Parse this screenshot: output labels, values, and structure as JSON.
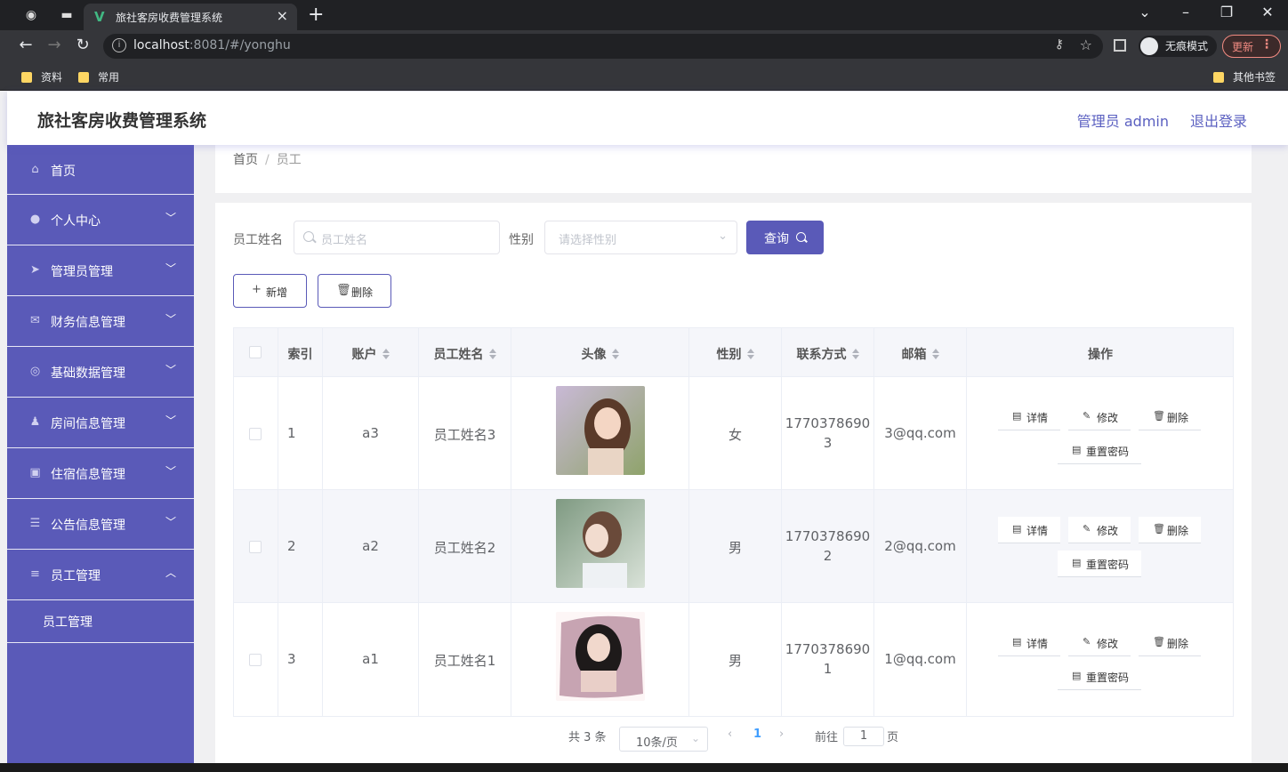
{
  "browser": {
    "tab_title": "旅社客房收费管理系统",
    "url_host": "localhost",
    "url_path": ":8081/#/yonghu",
    "incognito_label": "无痕模式",
    "update_label": "更新",
    "bookmarks": [
      "资料",
      "常用"
    ],
    "other_bookmarks": "其他书签"
  },
  "header": {
    "title": "旅社客房收费管理系统",
    "admin_label": "管理员 admin",
    "logout_label": "退出登录"
  },
  "sidebar": {
    "items": [
      {
        "label": "首页",
        "icon": "home-icon"
      },
      {
        "label": "个人中心",
        "icon": "user-icon"
      },
      {
        "label": "管理员管理",
        "icon": "send-icon"
      },
      {
        "label": "财务信息管理",
        "icon": "mail-icon"
      },
      {
        "label": "基础数据管理",
        "icon": "circle-icon"
      },
      {
        "label": "房间信息管理",
        "icon": "person-icon"
      },
      {
        "label": "住宿信息管理",
        "icon": "clipboard-icon"
      },
      {
        "label": "公告信息管理",
        "icon": "sliders-icon"
      },
      {
        "label": "员工管理",
        "icon": "list-icon"
      }
    ],
    "sub_item": "员工管理"
  },
  "breadcrumb": {
    "home": "首页",
    "current": "员工"
  },
  "search": {
    "name_label": "员工姓名",
    "name_placeholder": "员工姓名",
    "gender_label": "性别",
    "gender_placeholder": "请选择性别",
    "query_label": "查询"
  },
  "actions": {
    "add_label": "新增",
    "delete_label": "删除"
  },
  "table": {
    "headers": {
      "index": "索引",
      "account": "账户",
      "name": "员工姓名",
      "avatar": "头像",
      "gender": "性别",
      "phone": "联系方式",
      "email": "邮箱",
      "ops": "操作"
    },
    "rows": [
      {
        "index": "1",
        "account": "a3",
        "name": "员工姓名3",
        "gender": "女",
        "phone_a": "1770378690",
        "phone_b": "3",
        "email": "3@qq.com"
      },
      {
        "index": "2",
        "account": "a2",
        "name": "员工姓名2",
        "gender": "男",
        "phone_a": "1770378690",
        "phone_b": "2",
        "email": "2@qq.com"
      },
      {
        "index": "3",
        "account": "a1",
        "name": "员工姓名1",
        "gender": "男",
        "phone_a": "1770378690",
        "phone_b": "1",
        "email": "1@qq.com"
      }
    ],
    "op_labels": {
      "detail": "详情",
      "edit": "修改",
      "delete": "删除",
      "reset": "重置密码"
    }
  },
  "pagination": {
    "total": "共 3 条",
    "page_size": "10条/页",
    "current_page": "1",
    "goto_label": "前往",
    "goto_value": "1",
    "page_suffix": "页"
  },
  "colors": {
    "primary": "#5a5ab8",
    "active_page": "#409eff"
  }
}
